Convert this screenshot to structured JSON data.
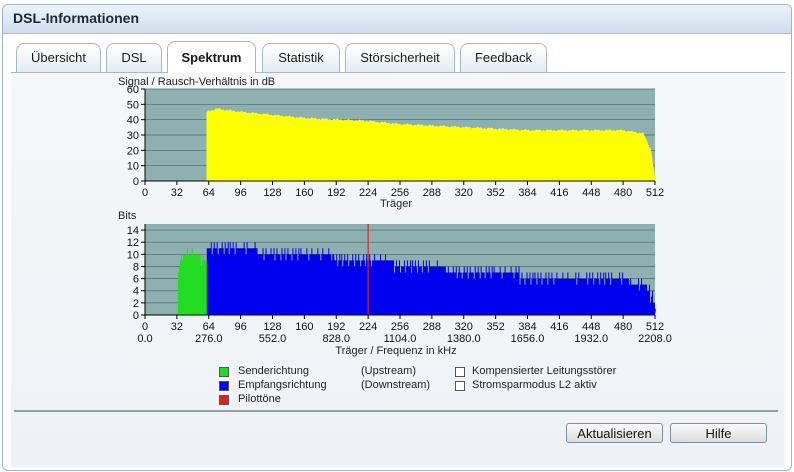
{
  "window": {
    "title": "DSL-Informationen"
  },
  "tabs": [
    {
      "label": "Übersicht",
      "active": false
    },
    {
      "label": "DSL",
      "active": false
    },
    {
      "label": "Spektrum",
      "active": true
    },
    {
      "label": "Statistik",
      "active": false
    },
    {
      "label": "Störsicherheit",
      "active": false
    },
    {
      "label": "Feedback",
      "active": false
    }
  ],
  "chart_data": [
    {
      "type": "bar",
      "title": "Signal / Rausch-Verhältnis in dB",
      "xlabel": "Träger",
      "ylabel": "",
      "xlim": [
        0,
        512
      ],
      "ylim": [
        0,
        60
      ],
      "x_ticks": [
        "0",
        "32",
        "64",
        "96",
        "128",
        "160",
        "192",
        "224",
        "256",
        "288",
        "320",
        "352",
        "384",
        "416",
        "448",
        "480",
        "512"
      ],
      "y_ticks": [
        "0",
        "10",
        "20",
        "30",
        "40",
        "50",
        "60"
      ],
      "grid": "horizontal",
      "background": "#8fb0b0",
      "series": [
        {
          "color": "#ffff00",
          "x_start": [
            62,
            72,
            96,
            128,
            160,
            192,
            224,
            256,
            288,
            320,
            352,
            384,
            416,
            448,
            480,
            500,
            508,
            512
          ],
          "values": [
            45,
            47,
            45,
            43,
            41,
            40,
            39,
            37,
            36,
            35,
            34,
            33,
            33,
            33,
            33,
            31,
            20,
            0
          ]
        }
      ]
    },
    {
      "type": "bar",
      "title": "Bits",
      "xlabel": "Träger / Frequenz in kHz",
      "ylabel": "",
      "xlim": [
        0,
        512
      ],
      "ylim": [
        0,
        15
      ],
      "x_ticks": [
        "0",
        "32",
        "64",
        "96",
        "128",
        "160",
        "192",
        "224",
        "256",
        "288",
        "320",
        "352",
        "384",
        "416",
        "448",
        "480",
        "512"
      ],
      "x_ticks_secondary": [
        "0.0",
        "276.0",
        "552.0",
        "828.0",
        "1104.0",
        "1380.0",
        "1656.0",
        "1932.0",
        "2208.0"
      ],
      "y_ticks": [
        "0",
        "2",
        "4",
        "6",
        "8",
        "10",
        "12",
        "14"
      ],
      "grid": "horizontal",
      "background": "#8fb0b0",
      "series": [
        {
          "name": "Senderichtung",
          "color": "#22dd22",
          "x_range": [
            33,
            62
          ],
          "values_profile": [
            [
              33,
              8
            ],
            [
              36,
              9
            ],
            [
              40,
              10
            ],
            [
              50,
              10
            ],
            [
              58,
              9
            ],
            [
              62,
              9
            ]
          ]
        },
        {
          "name": "Empfangsrichtung",
          "color": "#0000ee",
          "x_range": [
            62,
            512
          ],
          "values_profile": [
            [
              62,
              11
            ],
            [
              96,
              11
            ],
            [
              128,
              10
            ],
            [
              176,
              10
            ],
            [
              200,
              9
            ],
            [
              224,
              9
            ],
            [
              272,
              8
            ],
            [
              330,
              7
            ],
            [
              420,
              6
            ],
            [
              470,
              6
            ],
            [
              500,
              5
            ],
            [
              508,
              3
            ],
            [
              512,
              1
            ]
          ]
        },
        {
          "name": "Pilottöne",
          "color": "#dd2222",
          "x_positions": [
            224
          ]
        }
      ]
    }
  ],
  "legend": [
    {
      "color": "#22dd22",
      "label": "Senderichtung",
      "note": "(Upstream)"
    },
    {
      "color": "#0000ee",
      "label": "Empfangsrichtung",
      "note": "(Downstream)"
    },
    {
      "color": "#dd2222",
      "label": "Pilottöne",
      "note": ""
    },
    {
      "color": "#ffffff",
      "label": "Kompensierter Leitungsstörer",
      "note": ""
    },
    {
      "color": "#ffffff",
      "label": "Stromsparmodus L2 aktiv",
      "note": ""
    }
  ],
  "buttons": {
    "refresh": "Aktualisieren",
    "help": "Hilfe"
  }
}
